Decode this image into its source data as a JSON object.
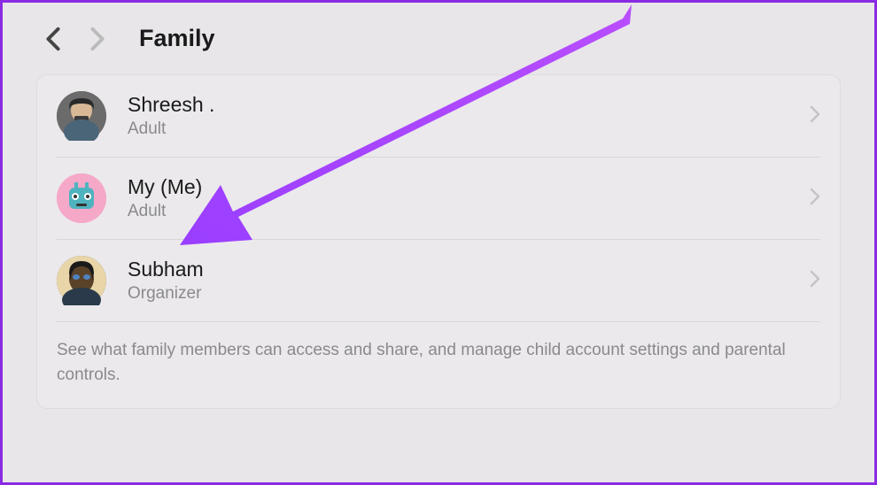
{
  "header": {
    "title": "Family"
  },
  "members": [
    {
      "name": "Shreesh .",
      "role": "Adult"
    },
    {
      "name": "My (Me)",
      "role": "Adult"
    },
    {
      "name": "Subham",
      "role": "Organizer"
    }
  ],
  "footer": {
    "text": "See what family members can access and share, and manage child account settings and parental controls."
  },
  "colors": {
    "accent": "#8a2be2"
  }
}
